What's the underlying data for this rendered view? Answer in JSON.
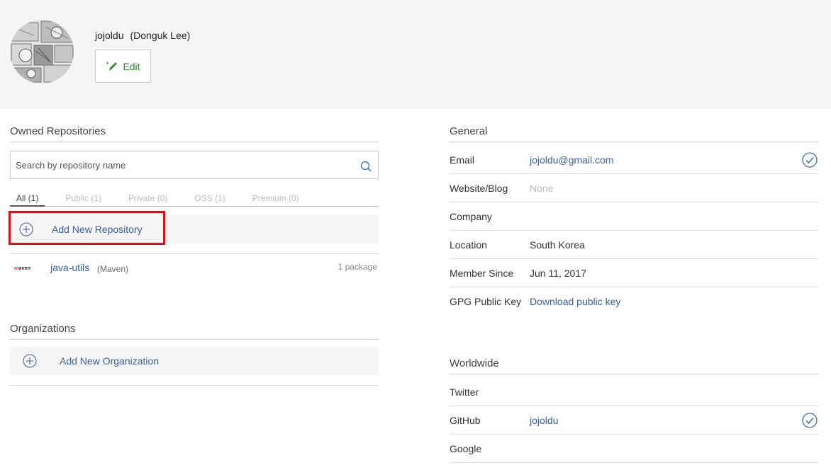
{
  "profile": {
    "username": "jojoldu",
    "full_name": "(Donguk Lee)",
    "edit_label": "Edit"
  },
  "repositories": {
    "title": "Owned Repositories",
    "search_placeholder": "Search by repository name",
    "tabs": [
      {
        "label": "All (1)",
        "active": true
      },
      {
        "label": "Public (1)",
        "active": false
      },
      {
        "label": "Private (0)",
        "active": false
      },
      {
        "label": "OSS (1)",
        "active": false
      },
      {
        "label": "Premium (0)",
        "active": false
      }
    ],
    "add_label": "Add New Repository",
    "items": [
      {
        "logo": "maven",
        "name": "java-utils",
        "type": "(Maven)",
        "count": "1 package"
      }
    ]
  },
  "organizations": {
    "title": "Organizations",
    "add_label": "Add New Organization"
  },
  "general": {
    "title": "General",
    "rows": [
      {
        "key": "Email",
        "value": "jojoldu@gmail.com",
        "style": "link",
        "verified": true
      },
      {
        "key": "Website/Blog",
        "value": "None",
        "style": "muted",
        "verified": false
      },
      {
        "key": "Company",
        "value": "",
        "style": "plain",
        "verified": false
      },
      {
        "key": "Location",
        "value": "South Korea",
        "style": "plain",
        "verified": false
      },
      {
        "key": "Member Since",
        "value": "Jun 11, 2017",
        "style": "plain",
        "verified": false
      },
      {
        "key": "GPG Public Key",
        "value": "Download public key",
        "style": "link",
        "verified": false
      }
    ]
  },
  "worldwide": {
    "title": "Worldwide",
    "rows": [
      {
        "key": "Twitter",
        "value": "",
        "style": "plain",
        "verified": false
      },
      {
        "key": "GitHub",
        "value": "jojoldu",
        "style": "link",
        "verified": true
      },
      {
        "key": "Google",
        "value": "",
        "style": "plain",
        "verified": false
      }
    ]
  },
  "colors": {
    "link": "#3b5f9a",
    "edit_green": "#2a8a2a",
    "highlight_red": "#d3171e",
    "header_bg": "#f5f5f5"
  }
}
